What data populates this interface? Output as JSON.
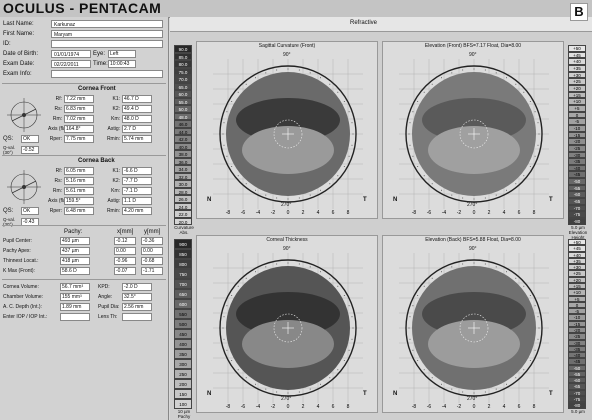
{
  "app": {
    "title": "OCULUS - PENTACAM",
    "panel_letter": "B"
  },
  "patient": {
    "fields": [
      {
        "label": "Last Name:",
        "value": "Karkunaz"
      },
      {
        "label": "First Name:",
        "value": "Maryam"
      },
      {
        "label": "ID:",
        "value": ""
      },
      {
        "label": "Date of Birth:",
        "value": "01/01/1974"
      },
      {
        "label": "Exam Date:",
        "value": "02/22/2011"
      },
      {
        "label": "Exam Info:",
        "value": ""
      }
    ],
    "eye_label": "Eye:",
    "eye_value": "Left",
    "time_label": "Time:",
    "time_value": "10:00:43"
  },
  "cornea_front": {
    "title": "Cornea Front",
    "rows": [
      {
        "l1": "Rf:",
        "v1": "7.22 mm",
        "l2": "K1:",
        "v2": "46.7 D"
      },
      {
        "l1": "Rs:",
        "v1": "6.83 mm",
        "l2": "K2:",
        "v2": "49.4 D"
      },
      {
        "l1": "Rm:",
        "v1": "7.02 mm",
        "l2": "Km:",
        "v2": "48.0 D"
      },
      {
        "l1": "Axis (flat):",
        "v1": "164.8°",
        "l2": "Astig:",
        "v2": "2.7 D"
      },
      {
        "l1": "Rper:",
        "v1": "7.75 mm",
        "l2": "Rmin:",
        "v2": "5.74 mm"
      }
    ],
    "qs_label": "QS:",
    "qs_value": "OK",
    "q_label": "Q-val. (30°)",
    "q_value": "-0.52"
  },
  "cornea_back": {
    "title": "Cornea Back",
    "rows": [
      {
        "l1": "Rf:",
        "v1": "6.05 mm",
        "l2": "K1:",
        "v2": "-6.6 D"
      },
      {
        "l1": "Rs:",
        "v1": "5.16 mm",
        "l2": "K2:",
        "v2": "-7.7 D"
      },
      {
        "l1": "Rm:",
        "v1": "5.61 mm",
        "l2": "Km:",
        "v2": "-7.1 D"
      },
      {
        "l1": "Axis (flat):",
        "v1": "159.5°",
        "l2": "Astig:",
        "v2": "1.1 D"
      },
      {
        "l1": "Rper:",
        "v1": "6.48 mm",
        "l2": "Rmin:",
        "v2": "4.20 mm"
      }
    ],
    "qs_label": "QS:",
    "qs_value": "OK",
    "q_label": "Q-val. (30°)",
    "q_value": "-0.43"
  },
  "pachy": {
    "col_pachy": "Pachy:",
    "col_x": "x[mm]",
    "col_y": "y[mm]",
    "rows": [
      {
        "label": "Pupil Center:",
        "pachy": "493 µm",
        "x": "-0.12",
        "y": "-0.36"
      },
      {
        "label": "Pachy Apex:",
        "pachy": "437 µm",
        "x": "0.00",
        "y": "0.00"
      },
      {
        "label": "Thinnest Locat.:",
        "pachy": "418 µm",
        "x": "-0.96",
        "y": "-0.68"
      },
      {
        "label": "K Max (Front):",
        "pachy": "58.6 D",
        "x": "-0.07",
        "y": "-1.71"
      }
    ]
  },
  "volumes": {
    "rows": [
      {
        "l1": "Cornea Volume:",
        "v1": "56.7 mm³",
        "l2": "KPD:",
        "v2": "-2.0 D"
      },
      {
        "l1": "Chamber Volume:",
        "v1": "155 mm³",
        "l2": "Angle:",
        "v2": "32.5°"
      },
      {
        "l1": "A. C. Depth (Int.):",
        "v1": "1.89 mm",
        "l2": "Pupil Dia:",
        "v2": "2.56 mm"
      },
      {
        "l1": "Enter IOP / IOP Int.:",
        "v1": "",
        "l2": "Lens Th:",
        "v2": ""
      }
    ]
  },
  "refractive": {
    "title": "Refractive"
  },
  "maps": [
    {
      "title": "Sagittal Curvature (Front)",
      "n": "N",
      "t": "T",
      "top_axis": "90°",
      "bottom_axis": "270°"
    },
    {
      "title": "Elevation (Front) BFS=7.17 Float, Dia=8.00",
      "n": "N",
      "t": "T",
      "top_axis": "90°",
      "bottom_axis": "270°"
    },
    {
      "title": "Corneal Thickness",
      "n": "N",
      "t": "T",
      "top_axis": "90°",
      "bottom_axis": "270°"
    },
    {
      "title": "Elevation (Back) BFS=5.88 Float, Dia=8.00",
      "n": "N",
      "t": "T",
      "top_axis": "90°",
      "bottom_axis": "270°"
    }
  ],
  "scales": {
    "curvature": [
      "90.0",
      "85.0",
      "80.0",
      "75.0",
      "70.0",
      "65.0",
      "60.0",
      "55.0",
      "50.0",
      "48.0",
      "46.0",
      "44.0",
      "42.0",
      "40.0",
      "38.0",
      "36.0",
      "34.0",
      "32.0",
      "30.0",
      "28.0",
      "26.0",
      "24.0",
      "22.0",
      "20.0"
    ],
    "curvature_unit": "Curvature Abs.",
    "elev_front": [
      "+50",
      "+45",
      "+40",
      "+35",
      "+30",
      "+25",
      "+20",
      "+15",
      "+10",
      "+5",
      "0",
      "-5",
      "-10",
      "-15",
      "-20",
      "-25",
      "-30",
      "-35",
      "-40",
      "-45",
      "-50",
      "-55",
      "-60",
      "-65",
      "-70",
      "-75",
      "-80"
    ],
    "elev_unit_front": "5.0 µm Elevation Height",
    "pachy": [
      "900",
      "850",
      "800",
      "750",
      "700",
      "650",
      "600",
      "550",
      "500",
      "450",
      "400",
      "350",
      "300",
      "250",
      "200",
      "150",
      "100"
    ],
    "pachy_unit": "10 µm Pachy",
    "elev_back": [
      "+50",
      "+45",
      "+40",
      "+35",
      "+30",
      "+25",
      "+20",
      "+15",
      "+10",
      "+5",
      "0",
      "-5",
      "-10",
      "-15",
      "-20",
      "-25",
      "-30",
      "-35",
      "-40",
      "-45",
      "-50",
      "-55",
      "-60",
      "-65",
      "-70",
      "-75",
      "-80"
    ],
    "elev_unit_back": "5.0 µm"
  }
}
